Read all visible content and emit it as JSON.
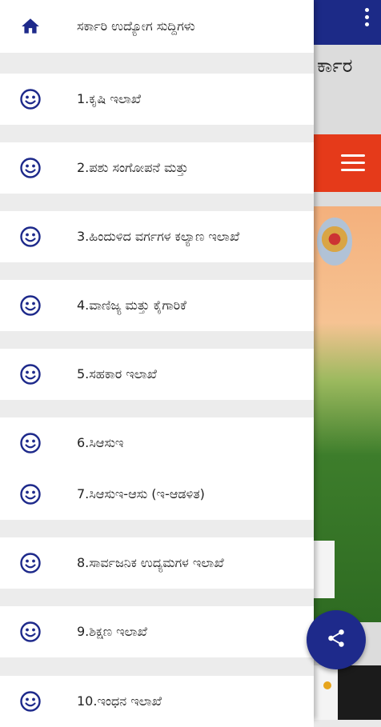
{
  "background_app": {
    "title_fragment": "ರ್ಕಾರ",
    "colors": {
      "topbar": "#1c2a87",
      "orange_band": "#e53a1a"
    },
    "icons": [
      "overflow-menu-icon",
      "hamburger-menu-icon",
      "emblem-seal"
    ]
  },
  "drawer": {
    "header_item": {
      "label": "ಸರ್ಕಾರಿ ಉದ್ಯೋಗ ಸುದ್ದಿಗಳು",
      "icon": "home-icon"
    },
    "items": [
      {
        "label": "1.ಕೃಷಿ ಇಲಾಖೆ",
        "icon": "smiley-icon"
      },
      {
        "label": "2.ಪಶು ಸಂಗೋಪನೆ ಮತ್ತು",
        "icon": "smiley-icon"
      },
      {
        "label": "3.ಹಿಂದುಳಿದ ವರ್ಗಗಳ ಕಲ್ಯಾಣ ಇಲಾಖೆ",
        "icon": "smiley-icon"
      },
      {
        "label": "4.ವಾಣಿಜ್ಯ ಮತ್ತು ಕೈಗಾರಿಕೆ",
        "icon": "smiley-icon"
      },
      {
        "label": "5.ಸಹಕಾರ ಇಲಾಖೆ",
        "icon": "smiley-icon"
      },
      {
        "label": "6.ಸಿಆಸುಇ",
        "icon": "smiley-icon"
      },
      {
        "label": "7.ಸಿಆಸುಇ-ಆಸು (ಇ-ಆಡಳಿತ)",
        "icon": "smiley-icon"
      },
      {
        "label": "8.ಸಾರ್ವಜನಿಕ ಉದ್ಯಮಗಳ ಇಲಾಖೆ",
        "icon": "smiley-icon"
      },
      {
        "label": "9.ಶಿಕ್ಷಣ ಇಲಾಖೆ",
        "icon": "smiley-icon"
      },
      {
        "label": "10.ಇಂಧನ ಇಲಾಖೆ",
        "icon": "smiley-icon"
      }
    ],
    "colors": {
      "icon": "#1e2a8b",
      "text": "#222222",
      "separator": "#ececec"
    }
  },
  "fab": {
    "icon": "share-icon",
    "color": "#1e2a8b"
  }
}
